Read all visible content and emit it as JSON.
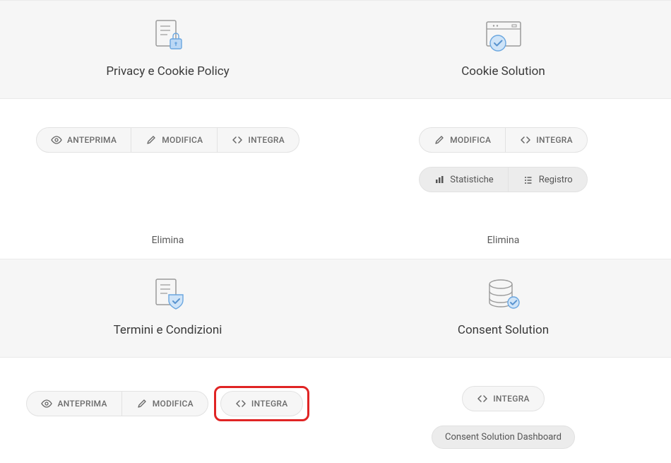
{
  "actions": {
    "anteprima": "ANTEPRIMA",
    "modifica": "MODIFICA",
    "integra": "INTEGRA",
    "statistiche": "Statistiche",
    "registro": "Registro",
    "elimina": "Elimina"
  },
  "cards": {
    "privacy": {
      "title": "Privacy e Cookie Policy"
    },
    "cookie": {
      "title": "Cookie Solution"
    },
    "terms": {
      "title": "Termini e Condizioni"
    },
    "consent": {
      "title": "Consent Solution",
      "dashboard": "Consent Solution Dashboard"
    }
  }
}
